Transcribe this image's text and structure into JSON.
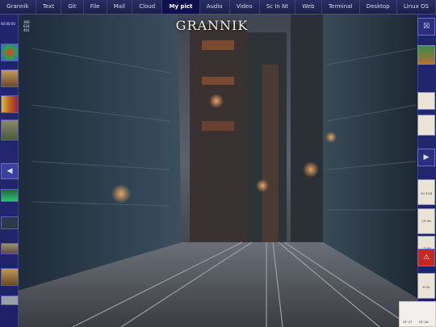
{
  "menubar": {
    "items": [
      {
        "label": "Grannik"
      },
      {
        "label": "Text"
      },
      {
        "label": "Git"
      },
      {
        "label": "File"
      },
      {
        "label": "Mail"
      },
      {
        "label": "Cloud"
      },
      {
        "label": "My pict"
      },
      {
        "label": "Audio"
      },
      {
        "label": "Video"
      },
      {
        "label": "Sc In Nt"
      },
      {
        "label": "Web"
      },
      {
        "label": "Terminal"
      },
      {
        "label": "Desktop"
      },
      {
        "label": "Linux OS"
      }
    ],
    "active_index": 6
  },
  "title": "GRANNIK",
  "left": {
    "time": "00:00:00",
    "stats": [
      "366",
      "634",
      "401"
    ]
  },
  "right": {
    "page_labels": [
      "52-104",
      "29-58",
      "27-46",
      "6-50"
    ],
    "bottom_labels": [
      "01-27",
      "01-28"
    ]
  },
  "colors": {
    "accent": "#1b1f6e",
    "active": "#101050",
    "warning": "#d62b1f"
  },
  "icons": [
    "cross-box-icon",
    "gear-icon",
    "left-arrow-icon",
    "right-arrow-icon",
    "warning-icon"
  ]
}
